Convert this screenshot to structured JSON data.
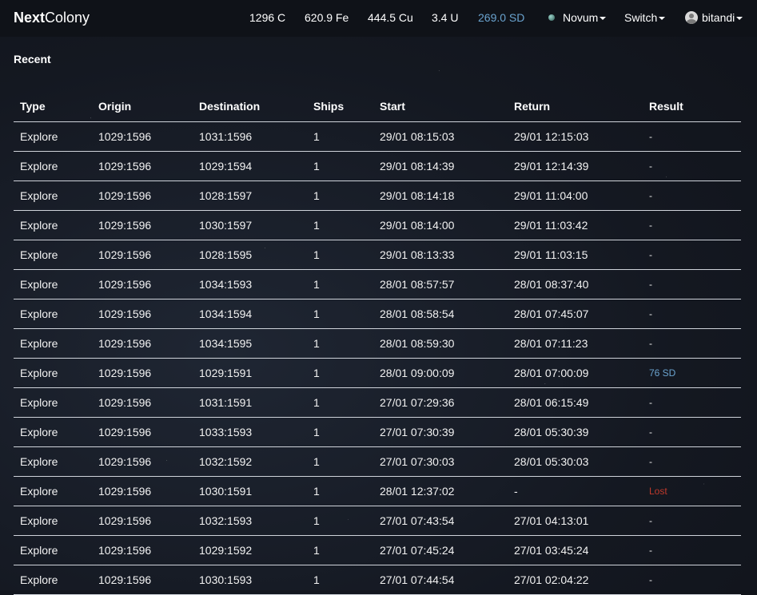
{
  "brand": {
    "bold": "Next",
    "rest": "Colony"
  },
  "resources": {
    "c": "1296 C",
    "fe": "620.9 Fe",
    "cu": "444.5 Cu",
    "u": "3.4 U",
    "sd": "269.0 SD"
  },
  "nav": {
    "planet": "Novum",
    "switch": "Switch",
    "user": "bitandi"
  },
  "section_title": "Recent",
  "table": {
    "headers": [
      "Type",
      "Origin",
      "Destination",
      "Ships",
      "Start",
      "Return",
      "Result"
    ],
    "rows": [
      [
        "Explore",
        "1029:1596",
        "1031:1596",
        "1",
        "29/01 08:15:03",
        "29/01 12:15:03",
        "-"
      ],
      [
        "Explore",
        "1029:1596",
        "1029:1594",
        "1",
        "29/01 08:14:39",
        "29/01 12:14:39",
        "-"
      ],
      [
        "Explore",
        "1029:1596",
        "1028:1597",
        "1",
        "29/01 08:14:18",
        "29/01 11:04:00",
        "-"
      ],
      [
        "Explore",
        "1029:1596",
        "1030:1597",
        "1",
        "29/01 08:14:00",
        "29/01 11:03:42",
        "-"
      ],
      [
        "Explore",
        "1029:1596",
        "1028:1595",
        "1",
        "29/01 08:13:33",
        "29/01 11:03:15",
        "-"
      ],
      [
        "Explore",
        "1029:1596",
        "1034:1593",
        "1",
        "28/01 08:57:57",
        "28/01 08:37:40",
        "-"
      ],
      [
        "Explore",
        "1029:1596",
        "1034:1594",
        "1",
        "28/01 08:58:54",
        "28/01 07:45:07",
        "-"
      ],
      [
        "Explore",
        "1029:1596",
        "1034:1595",
        "1",
        "28/01 08:59:30",
        "28/01 07:11:23",
        "-"
      ],
      [
        "Explore",
        "1029:1596",
        "1029:1591",
        "1",
        "28/01 09:00:09",
        "28/01 07:00:09",
        "76 SD"
      ],
      [
        "Explore",
        "1029:1596",
        "1031:1591",
        "1",
        "27/01 07:29:36",
        "28/01 06:15:49",
        "-"
      ],
      [
        "Explore",
        "1029:1596",
        "1033:1593",
        "1",
        "27/01 07:30:39",
        "28/01 05:30:39",
        "-"
      ],
      [
        "Explore",
        "1029:1596",
        "1032:1592",
        "1",
        "27/01 07:30:03",
        "28/01 05:30:03",
        "-"
      ],
      [
        "Explore",
        "1029:1596",
        "1030:1591",
        "1",
        "28/01 12:37:02",
        "-",
        "Lost"
      ],
      [
        "Explore",
        "1029:1596",
        "1032:1593",
        "1",
        "27/01 07:43:54",
        "27/01 04:13:01",
        "-"
      ],
      [
        "Explore",
        "1029:1596",
        "1029:1592",
        "1",
        "27/01 07:45:24",
        "27/01 03:45:24",
        "-"
      ],
      [
        "Explore",
        "1029:1596",
        "1030:1593",
        "1",
        "27/01 07:44:54",
        "27/01 02:04:22",
        "-"
      ]
    ]
  },
  "colors": {
    "accent_sd": "#6aa3cf",
    "lost": "#c0392b",
    "navbar_bg": "#0f1218"
  },
  "icons": {
    "planet": "planet-icon",
    "caret": "caret-down-icon",
    "avatar": "user-avatar-icon"
  }
}
